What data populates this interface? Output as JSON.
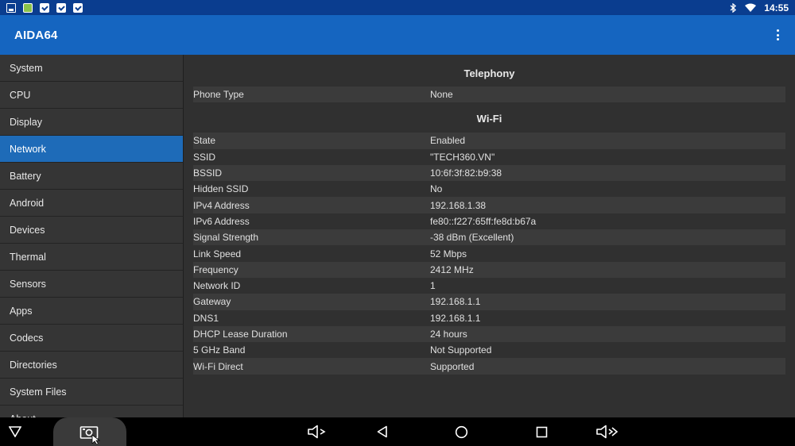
{
  "app": {
    "title": "AIDA64",
    "time": "14:55"
  },
  "colors": {
    "status_bar": "#0a3d8f",
    "app_bar": "#1565c0",
    "active_item": "#1e6bb8"
  },
  "sidebar": {
    "items": [
      {
        "label": "System"
      },
      {
        "label": "CPU"
      },
      {
        "label": "Display"
      },
      {
        "label": "Network",
        "active": true
      },
      {
        "label": "Battery"
      },
      {
        "label": "Android"
      },
      {
        "label": "Devices"
      },
      {
        "label": "Thermal"
      },
      {
        "label": "Sensors"
      },
      {
        "label": "Apps"
      },
      {
        "label": "Codecs"
      },
      {
        "label": "Directories"
      },
      {
        "label": "System Files"
      },
      {
        "label": "About"
      }
    ]
  },
  "content": {
    "telephony": {
      "title": "Telephony",
      "rows": [
        {
          "key": "Phone Type",
          "value": "None"
        }
      ]
    },
    "wifi": {
      "title": "Wi-Fi",
      "rows": [
        {
          "key": "State",
          "value": "Enabled"
        },
        {
          "key": "SSID",
          "value": "\"TECH360.VN\""
        },
        {
          "key": "BSSID",
          "value": "10:6f:3f:82:b9:38"
        },
        {
          "key": "Hidden SSID",
          "value": "No"
        },
        {
          "key": "IPv4 Address",
          "value": "192.168.1.38"
        },
        {
          "key": "IPv6 Address",
          "value": "fe80::f227:65ff:fe8d:b67a"
        },
        {
          "key": "Signal Strength",
          "value": "-38 dBm (Excellent)"
        },
        {
          "key": "Link Speed",
          "value": "52 Mbps"
        },
        {
          "key": "Frequency",
          "value": "2412 MHz"
        },
        {
          "key": "Network ID",
          "value": "1"
        },
        {
          "key": "Gateway",
          "value": "192.168.1.1"
        },
        {
          "key": "DNS1",
          "value": "192.168.1.1"
        },
        {
          "key": "DHCP Lease Duration",
          "value": "24 hours"
        },
        {
          "key": "5 GHz Band",
          "value": "Not Supported"
        },
        {
          "key": "Wi-Fi Direct",
          "value": "Supported"
        }
      ]
    }
  },
  "icons": {
    "status_left": [
      "gallery-icon",
      "app-icon",
      "bag-icon",
      "bag-icon",
      "bag-icon"
    ],
    "status_right": [
      "bluetooth-icon",
      "wifi-icon"
    ],
    "navbar": [
      "hide-nav-icon",
      "screenshot-icon",
      "volume-down-icon",
      "back-icon",
      "home-icon",
      "recents-icon",
      "volume-up-icon"
    ]
  }
}
